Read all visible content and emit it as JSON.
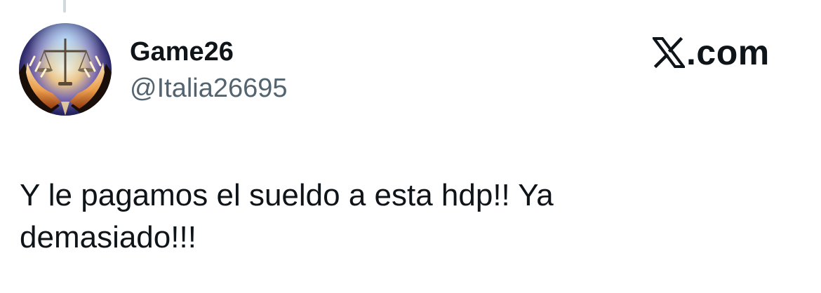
{
  "author": {
    "display_name": "Game26",
    "handle": "@Italia26695",
    "avatar_icon": "hands-holding-scales-avatar"
  },
  "brand": {
    "icon": "x-logo-icon",
    "text": ".com"
  },
  "tweet": {
    "text": "Y le pagamos el sueldo a esta hdp!! Ya\ndemasiado!!!"
  },
  "colors": {
    "name": "#0f1419",
    "handle": "#536471",
    "thread_line": "#cfd9de"
  }
}
